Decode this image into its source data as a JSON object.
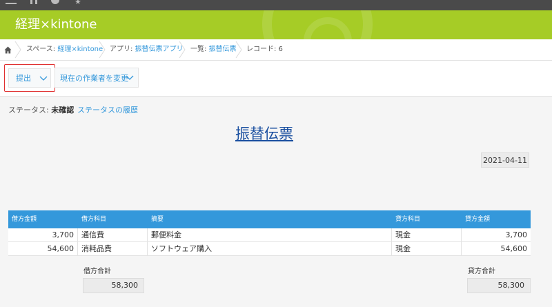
{
  "app": {
    "title": "経理×kintone"
  },
  "colors": {
    "header": "#a6cc26",
    "accent": "#3498db",
    "highlight": "#e03030"
  },
  "icons": {
    "home": "home-icon",
    "menu": "menu-icon",
    "bell": "bell-icon",
    "star": "star-icon",
    "chevron": "chevron-down-icon"
  },
  "breadcrumb": {
    "space_prefix": "スペース: ",
    "space_name": "経理×kintone",
    "app_prefix": "アプリ: ",
    "app_name": "振替伝票アプリ",
    "list_prefix": "一覧: ",
    "list_name": "振替伝票",
    "record": "レコード: 6"
  },
  "toolbar": {
    "submit_label": "提出",
    "change_assignee_label": "現在の作業者を変更"
  },
  "status": {
    "label": "ステータス: ",
    "value": "未確認",
    "history_link": "ステータスの履歴"
  },
  "form": {
    "title": "振替伝票",
    "date": "2021-04-11"
  },
  "table": {
    "headers": [
      "借方金額",
      "借方科目",
      "摘要",
      "貸方科目",
      "貸方金額"
    ],
    "rows": [
      [
        "3,700",
        "通信費",
        "郵便料金",
        "現金",
        "3,700"
      ],
      [
        "54,600",
        "消耗品費",
        "ソフトウェア購入",
        "現金",
        "54,600"
      ]
    ]
  },
  "totals": {
    "debit_label": "借方合計",
    "debit_value": "58,300",
    "credit_label": "貸方合計",
    "credit_value": "58,300"
  }
}
